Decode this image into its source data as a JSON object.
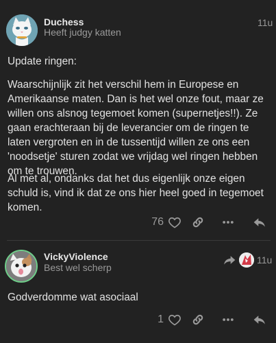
{
  "post1": {
    "username": "Duchess",
    "user_title": "Heeft judgy katten",
    "time": "11u",
    "paragraphs": [
      "Update ringen:",
      "Waarschijnlijk zit het verschil hem in Europese en Amerikaanse maten. Dan is het wel onze fout, maar ze willen ons alsnog tegemoet komen (supernetjes!!). Ze gaan erachteraan bij de leverancier om de ringen te laten vergroten en in de tussentijd willen ze ons een 'noodsetje' sturen zodat we vrijdag wel ringen hebben om te trouwen.",
      "Al met al, ondanks dat het dus eigenlijk onze eigen schuld is, vind ik dat ze ons hier heel goed in tegemoet komen."
    ],
    "like_count": "76",
    "icons": [
      "heart-icon",
      "link-icon",
      "more-icon",
      "reply-icon"
    ]
  },
  "post2": {
    "username": "VickyViolence",
    "user_title": "Best wel scherp",
    "time": "11u",
    "body": "Godverdomme wat asociaal",
    "like_count": "1",
    "icons": [
      "reply-to-arrow-icon",
      "heart-icon",
      "link-icon",
      "more-icon",
      "reply-icon"
    ]
  },
  "colors": {
    "background": "#222222",
    "text": "#dddddd",
    "muted": "#9a9a9a",
    "avatar_ring": "#6fcf8a"
  }
}
